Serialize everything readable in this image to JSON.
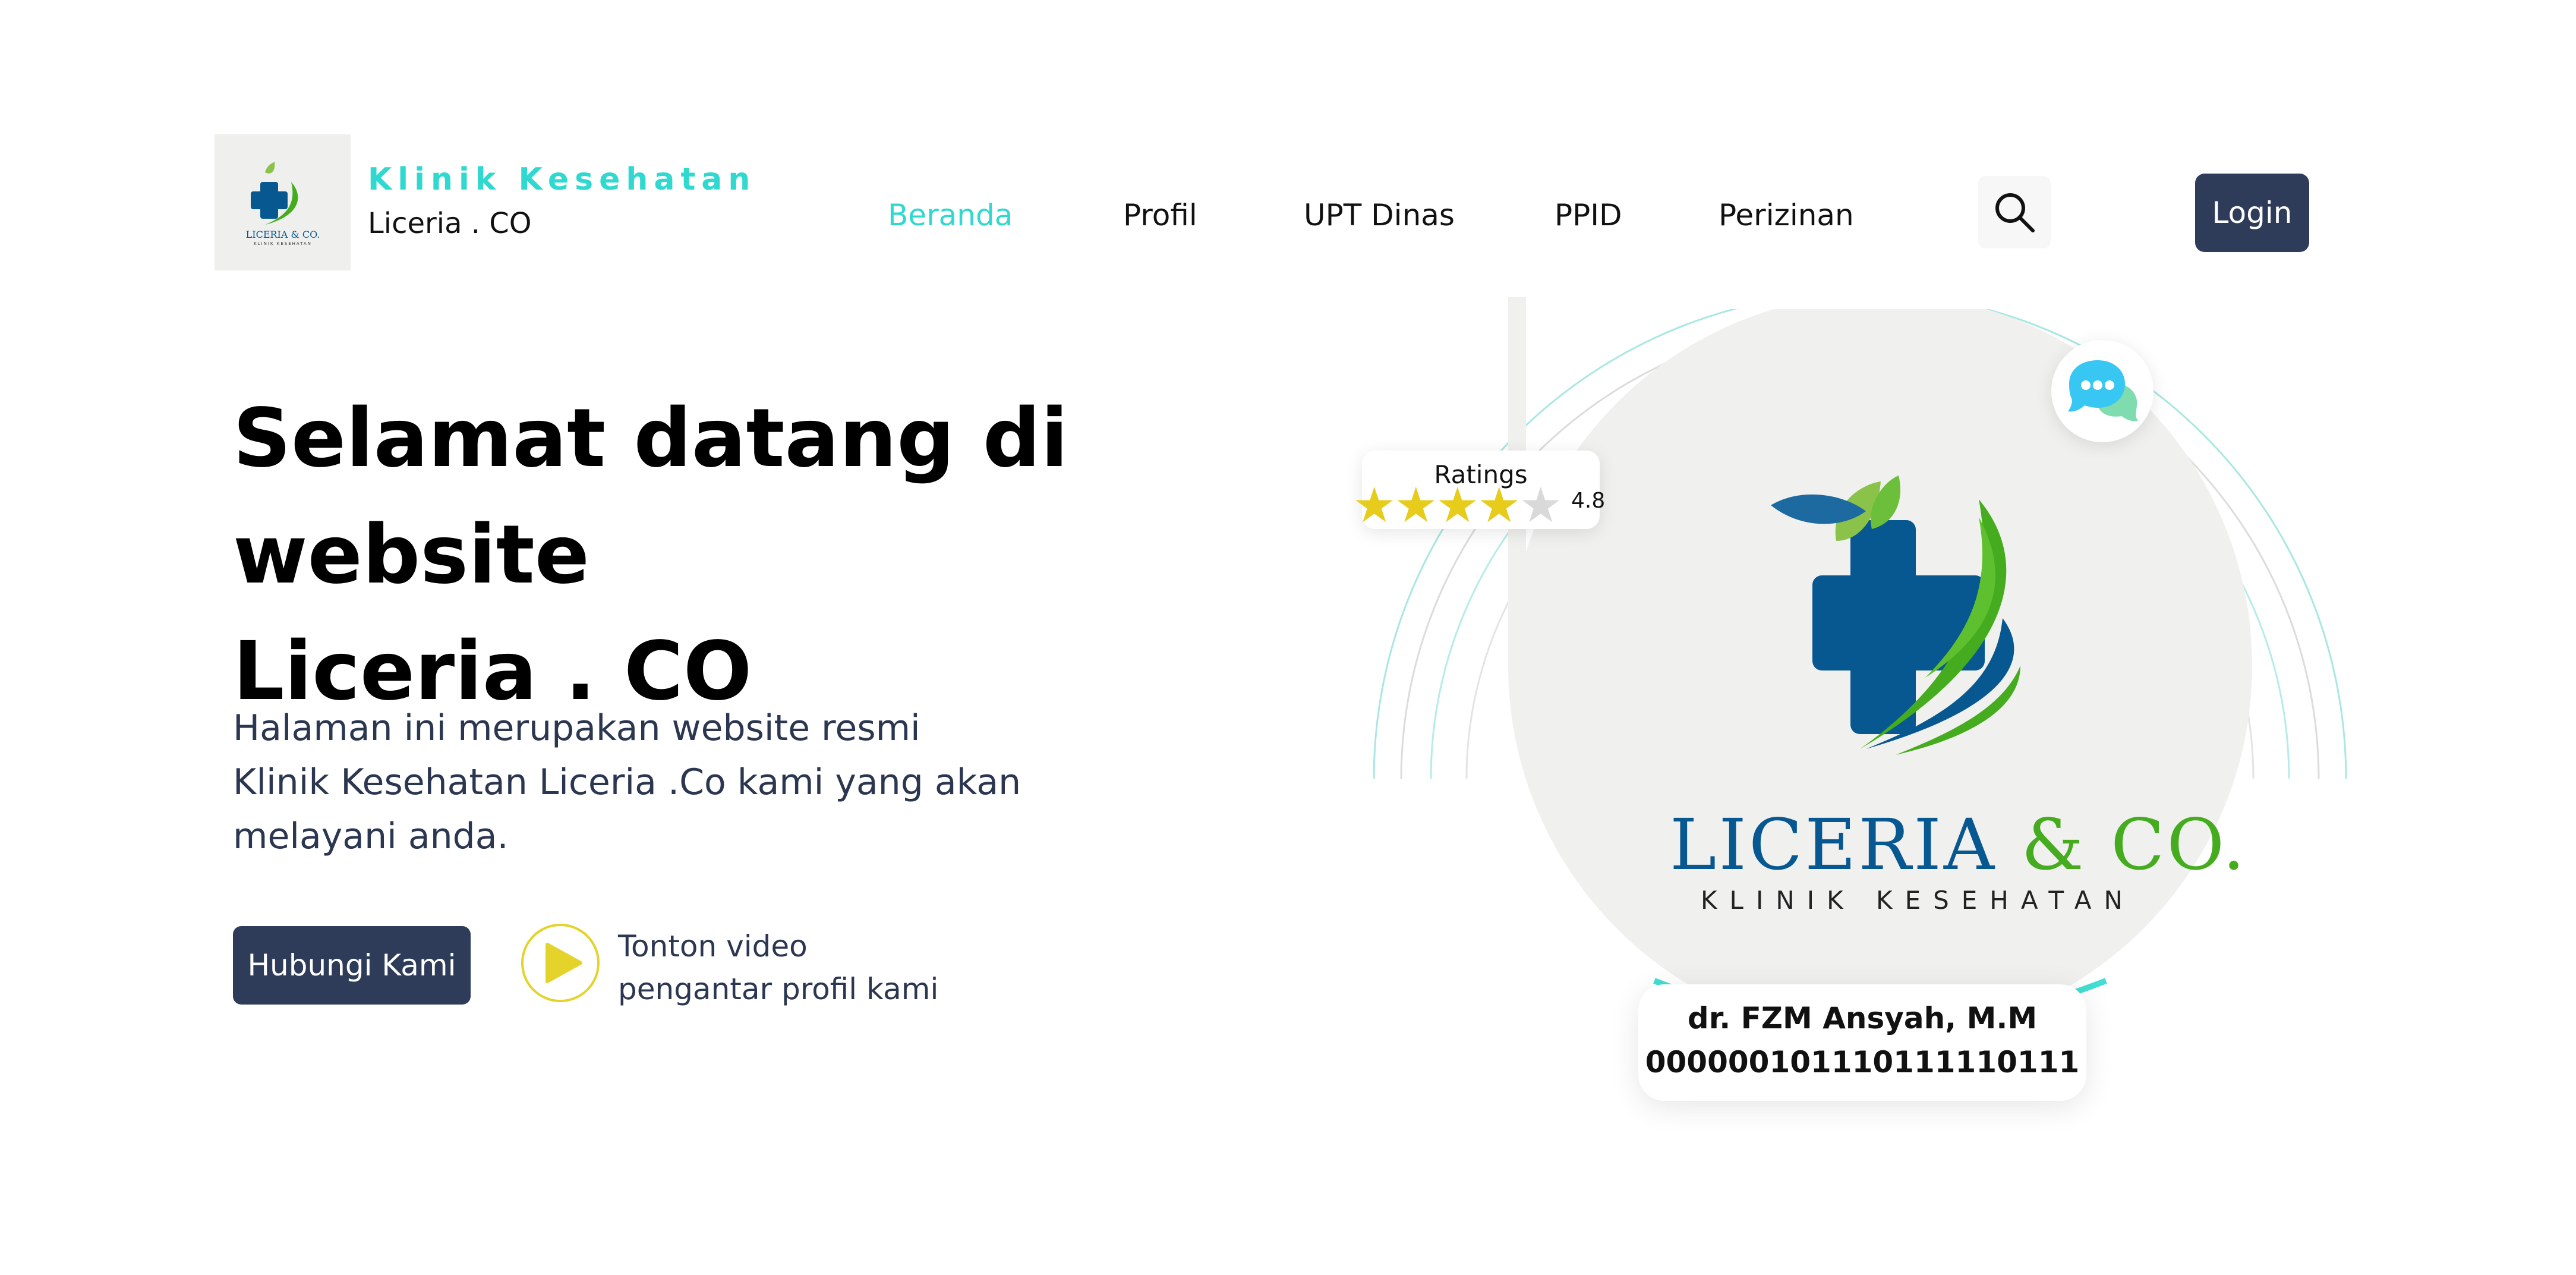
{
  "header": {
    "brand_top": "Klinik Kesehatan",
    "brand_bottom": "Liceria . CO",
    "nav": [
      {
        "label": "Beranda",
        "active": true
      },
      {
        "label": "Profil",
        "active": false
      },
      {
        "label": "UPT Dinas",
        "active": false
      },
      {
        "label": "PPID",
        "active": false
      },
      {
        "label": "Perizinan",
        "active": false
      }
    ],
    "search_icon": "search-icon",
    "login_label": "Login"
  },
  "hero": {
    "title_line1": "Selamat datang di website",
    "title_line2": "Liceria . CO",
    "desc_line1": "Halaman ini merupakan website resmi",
    "desc_line2": "Klinik Kesehatan Liceria .Co kami yang akan",
    "desc_line3": "melayani anda.",
    "contact_label": "Hubungi Kami",
    "video_line1": "Tonton video",
    "video_line2": "pengantar profil kami"
  },
  "ratings": {
    "title": "Ratings",
    "value": "4.8",
    "stars_full": 4,
    "stars_total": 5
  },
  "logo": {
    "word_blue": "LICERIA",
    "word_green": "& CO.",
    "subtitle": "KLINIK KESEHATAN"
  },
  "doctor": {
    "name": "dr. FZM Ansyah, M.M",
    "id": "000000101110111110111"
  },
  "colors": {
    "accent": "#2fd9cf",
    "navy": "#2e3c5a",
    "logo_blue": "#075891",
    "logo_green": "#44ac1e",
    "star": "#e7cc1c"
  }
}
